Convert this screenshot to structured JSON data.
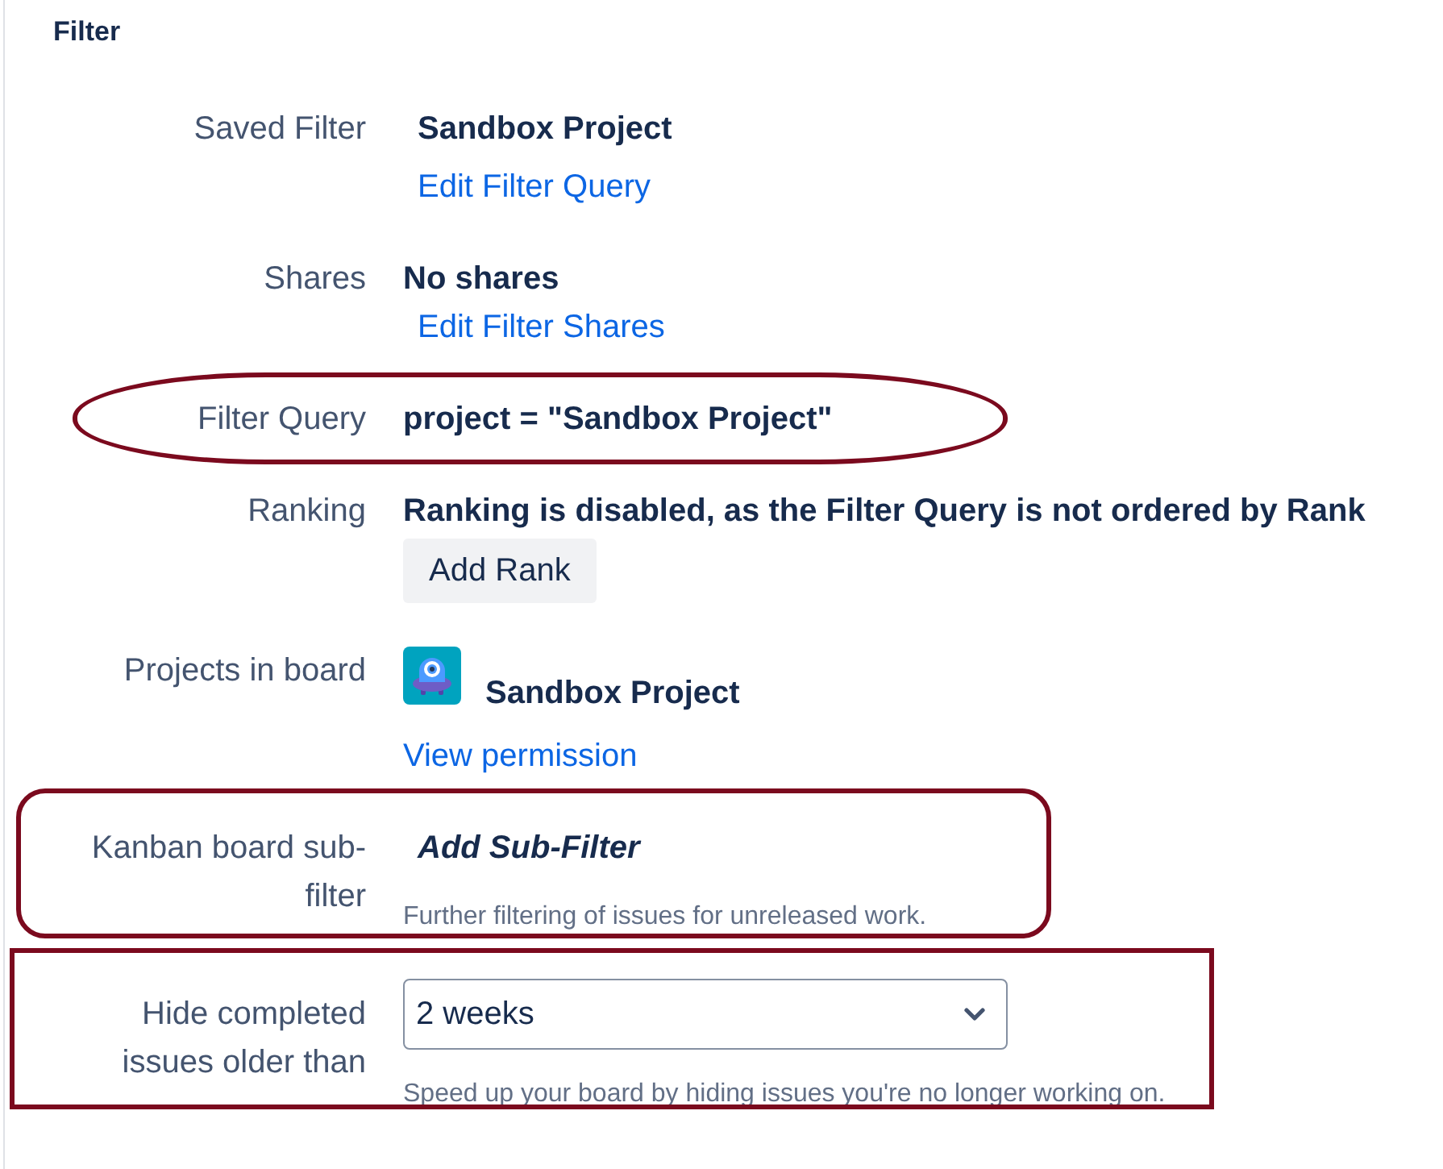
{
  "section": {
    "title": "Filter"
  },
  "rows": [
    {
      "label": "Saved Filter",
      "kind": "plain",
      "items": [
        {
          "kind": "name",
          "text": "Sandbox Project"
        },
        {
          "kind": "edit-link",
          "text": "Edit Filter Query"
        }
      ]
    },
    {
      "label": "Shares",
      "kind": "plain",
      "items": [
        {
          "kind": "text",
          "text": "No shares"
        },
        {
          "kind": "edit-link",
          "text": "Edit Filter Shares"
        }
      ]
    },
    {
      "label": "Filter Query",
      "kind": "ellipse",
      "items": [
        {
          "kind": "text",
          "text": "project = \"Sandbox Project\""
        }
      ]
    },
    {
      "label": "Ranking",
      "kind": "plain",
      "items": [
        {
          "kind": "text",
          "text": "Ranking is disabled, as the Filter Query is not ordered by Rank"
        },
        {
          "kind": "button",
          "text": "Add Rank"
        }
      ]
    },
    {
      "label": "Projects in board",
      "kind": "plain",
      "items": [
        {
          "kind": "project",
          "text": "Sandbox Project"
        },
        {
          "kind": "link",
          "text": "View permission"
        }
      ]
    },
    {
      "label": "Kanban board sub-filter",
      "kind": "rounded",
      "items": [
        {
          "kind": "action",
          "text": "Add Sub-Filter"
        },
        {
          "kind": "help",
          "text": "Further filtering of issues for unreleased work."
        }
      ]
    },
    {
      "label": "Hide completed issues older than",
      "kind": "boxed",
      "items": [
        {
          "kind": "select",
          "value": "2 weeks"
        },
        {
          "kind": "help",
          "text": "Speed up your board by hiding issues you're no longer working on."
        }
      ]
    }
  ]
}
